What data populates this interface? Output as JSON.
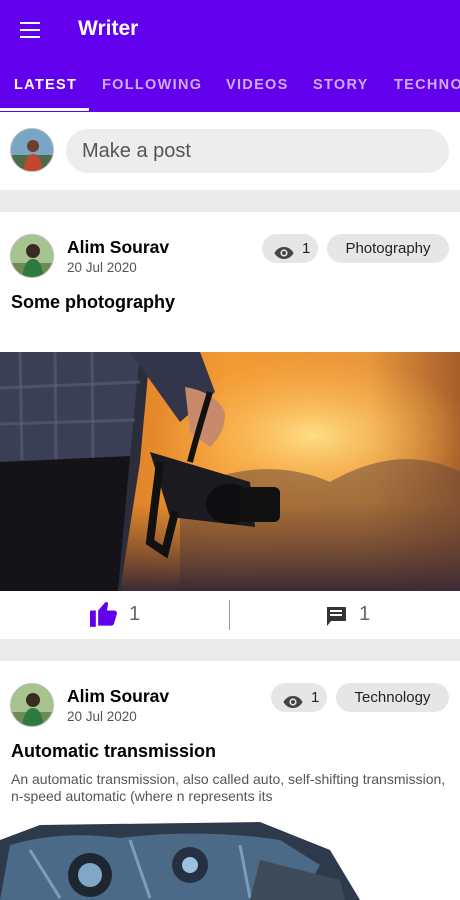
{
  "app": {
    "title": "Writer"
  },
  "icons": {
    "menu": "menu-icon",
    "views": "eye-icon",
    "like": "thumb-up-icon",
    "comment": "comment-icon"
  },
  "colors": {
    "accent": "#6200ee",
    "background": "#ebebeb",
    "surface": "#ffffff",
    "pill": "#e6e6e6"
  },
  "tabs": [
    {
      "label": "LATEST",
      "active": true
    },
    {
      "label": "FOLLOWING",
      "active": false
    },
    {
      "label": "VIDEOS",
      "active": false
    },
    {
      "label": "STORY",
      "active": false
    },
    {
      "label": "TECHNO",
      "active": false
    }
  ],
  "composer": {
    "placeholder": "Make a post"
  },
  "posts": [
    {
      "author": "Alim Sourav",
      "date": "20 Jul 2020",
      "views": "1",
      "category": "Photography",
      "title": "Some photography",
      "excerpt": "",
      "likes": "1",
      "comments": "1"
    },
    {
      "author": "Alim Sourav",
      "date": "20 Jul 2020",
      "views": "1",
      "category": "Technology",
      "title": "Automatic transmission",
      "excerpt": "An automatic transmission, also called auto, self-shifting transmission, n-speed automatic (where n represents its"
    }
  ]
}
